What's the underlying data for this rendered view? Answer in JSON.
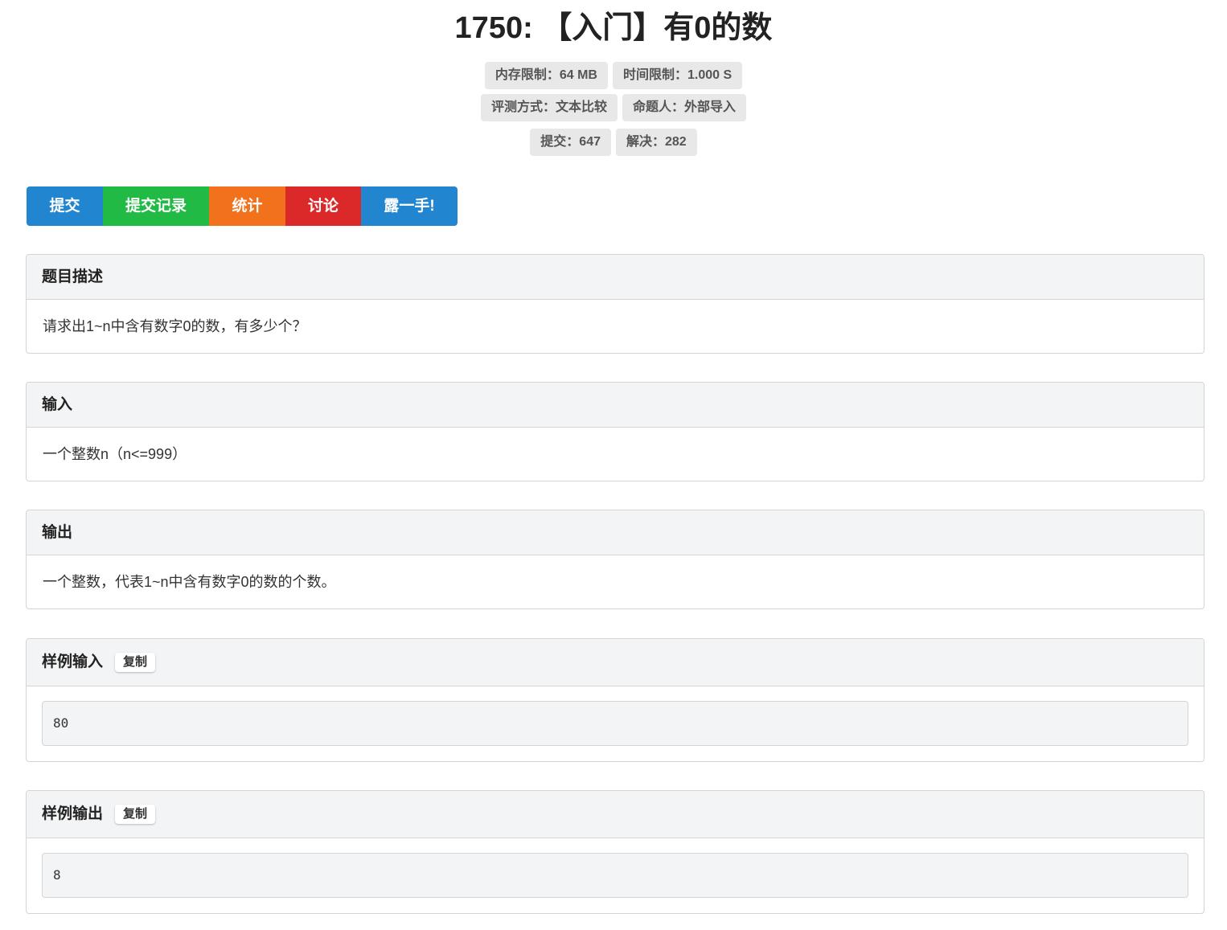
{
  "title": "1750: 【入门】有0的数",
  "badges": {
    "memory_limit": "内存限制：64 MB",
    "time_limit": "时间限制：1.000 S",
    "judge_method": "评测方式：文本比较",
    "author": "命题人：外部导入",
    "submissions": "提交：647",
    "solved": "解决：282"
  },
  "toolbar": {
    "submit": "提交",
    "records": "提交记录",
    "stats": "统计",
    "discuss": "讨论",
    "show_off": "露一手!"
  },
  "colors": {
    "blue": "#2185d0",
    "green": "#21ba45",
    "orange": "#f2711c",
    "red": "#db2828"
  },
  "sections": {
    "description": {
      "heading": "题目描述",
      "content": "请求出1~n中含有数字0的数，有多少个？"
    },
    "input": {
      "heading": "输入",
      "content": "一个整数n（n<=999）"
    },
    "output": {
      "heading": "输出",
      "content": "一个整数，代表1~n中含有数字0的数的个数。"
    },
    "sample_input": {
      "heading": "样例输入",
      "copy_label": "复制",
      "content": "80"
    },
    "sample_output": {
      "heading": "样例输出",
      "copy_label": "复制",
      "content": "8"
    }
  }
}
